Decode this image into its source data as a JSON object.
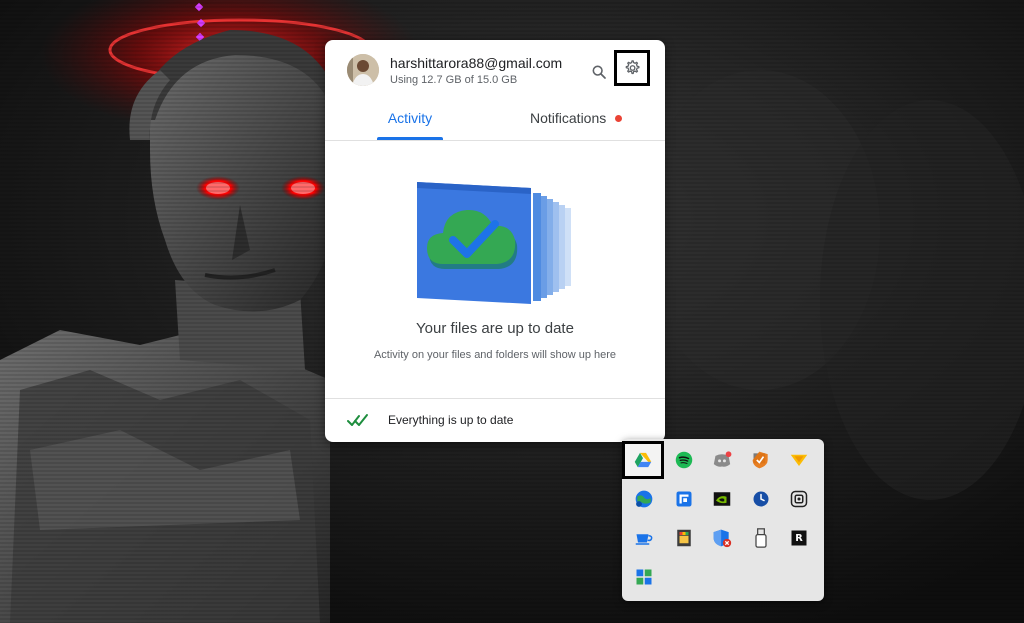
{
  "account": {
    "email": "harshittarora88@gmail.com",
    "storage": "Using 12.7 GB of 15.0 GB"
  },
  "tabs": {
    "activity": "Activity",
    "notifications": "Notifications"
  },
  "main": {
    "title": "Your files are up to date",
    "subtitle": "Activity on your files and folders will show up here"
  },
  "footer": {
    "status": "Everything is up to date"
  },
  "icons": {
    "search": "search-icon",
    "settings": "gear-icon",
    "sync_check": "double-check-icon",
    "notification_dot": "red-dot"
  },
  "tray": {
    "icons": [
      "google-drive-icon",
      "spotify-icon",
      "discord-icon",
      "security-shield-icon",
      "folder-arrow-icon",
      "network-globe-icon",
      "screen-capture-icon",
      "nvidia-icon",
      "clock-icon",
      "screenshot-tool-icon",
      "coffee-cup-icon",
      "color-picker-icon",
      "windows-defender-icon",
      "usb-drive-icon",
      "rockstar-launcher-icon",
      "app-grid-icon"
    ]
  },
  "colors": {
    "accent": "#1a73e8",
    "notification": "#ea4335",
    "check": "#1e8e3e",
    "tray_bg": "#e6e6e6",
    "highlight_border": "#000000"
  }
}
